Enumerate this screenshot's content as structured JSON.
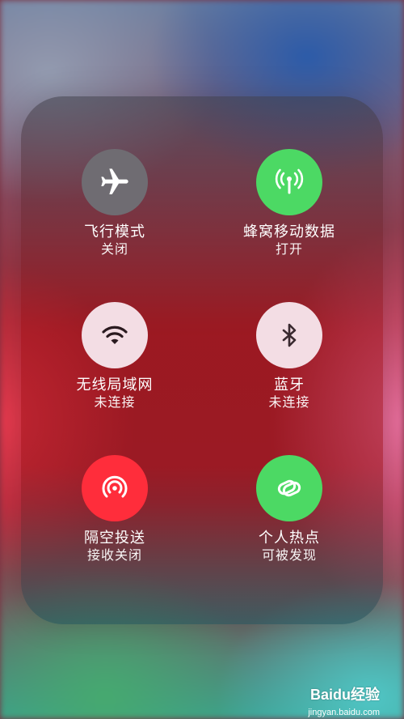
{
  "controls": [
    {
      "label": "飞行模式",
      "status": "关闭",
      "icon": "airplane-icon",
      "color": "#6f6c72"
    },
    {
      "label": "蜂窝移动数据",
      "status": "打开",
      "icon": "cellular-antenna-icon",
      "color": "#4cd964"
    },
    {
      "label": "无线局域网",
      "status": "未连接",
      "icon": "wifi-icon",
      "color": "#f3dde4"
    },
    {
      "label": "蓝牙",
      "status": "未连接",
      "icon": "bluetooth-icon",
      "color": "#f3dde4"
    },
    {
      "label": "隔空投送",
      "status": "接收关闭",
      "icon": "airdrop-icon",
      "color": "#ff2d3b"
    },
    {
      "label": "个人热点",
      "status": "可被发现",
      "icon": "hotspot-link-icon",
      "color": "#4cd964"
    }
  ],
  "watermark": {
    "brand": "Baidu经验",
    "url": "jingyan.baidu.com"
  }
}
